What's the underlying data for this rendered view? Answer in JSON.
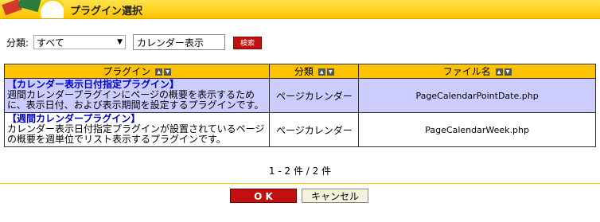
{
  "header": {
    "title": "プラグイン選択"
  },
  "search": {
    "category_label": "分類:",
    "category_value": "すべて",
    "keyword_value": "カレンダー表示",
    "search_label": "検索"
  },
  "table": {
    "headers": {
      "plugin": "プラグイン",
      "category": "分類",
      "filename": "ファイル名"
    },
    "rows": [
      {
        "name": "【カレンダー表示日付指定プラグイン】",
        "desc": "週間カレンダープラグインにページの概要を表示するために、表示日付、および表示期間を設定するプラグインです。",
        "category": "ページカレンダー",
        "filename": "PageCalendarPointDate.php"
      },
      {
        "name": "【週間カレンダープラグイン】",
        "desc": "カレンダー表示日付指定プラグインが設置されているページの概要を週単位でリスト表示するプラグインです。",
        "category": "ページカレンダー",
        "filename": "PageCalendarWeek.php"
      }
    ]
  },
  "pager": {
    "text": "1 - 2 件 / 2 件"
  },
  "buttons": {
    "ok": "O K",
    "cancel": "キャンセル"
  },
  "colors": {
    "header": "#ffc400",
    "accent_red": "#c01010",
    "row_highlight": "#ccccff",
    "link": "#0000cc"
  }
}
